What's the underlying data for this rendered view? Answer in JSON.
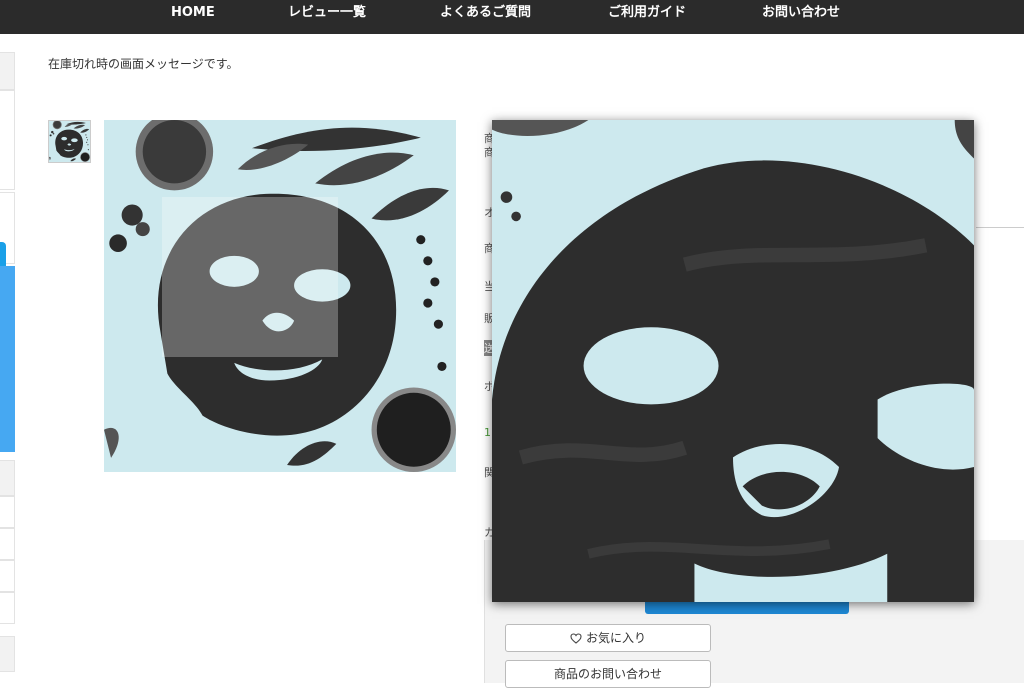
{
  "nav": {
    "items": [
      "HOME",
      "レビュー一覧",
      "よくあるご質問",
      "ご利用ガイド",
      "お問い合わせ"
    ]
  },
  "product": {
    "stock_message": "在庫切れ時の画面メッセージです。",
    "image_alt": "black charcoal sheet face mask on light blue background",
    "detail_fragments": [
      "商",
      "商",
      "オ",
      "商",
      "当",
      "販",
      "送",
      "ポ",
      "1",
      "関",
      "カ"
    ]
  },
  "actions": {
    "favorite_label": "お気に入り",
    "inquiry_label": "商品のお問い合わせ"
  },
  "icons": {
    "favorite": "heart-outline-icon"
  },
  "colors": {
    "nav_bg": "#2b2b2b",
    "accent_blue": "#1e88d4",
    "sidebar_blue": "#46a8f2",
    "image_bg": "#cde9ee",
    "mask": "#2c2c2c"
  }
}
